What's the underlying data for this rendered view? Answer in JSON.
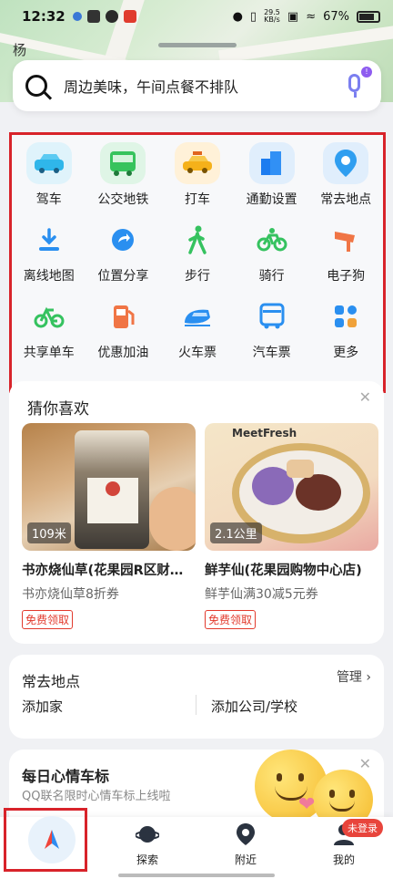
{
  "status_bar": {
    "time": "12:32",
    "net_speed_value": "29.5",
    "net_speed_unit": "KB/s",
    "battery": "67%"
  },
  "map": {
    "label": "杨"
  },
  "search": {
    "placeholder": "周边美味，午间点餐不排队",
    "mic_badge": "!"
  },
  "grid": [
    {
      "label": "驾车",
      "icon": "car-icon",
      "color": "#2fb6ea"
    },
    {
      "label": "公交地铁",
      "icon": "bus-icon",
      "color": "#37c35d"
    },
    {
      "label": "打车",
      "icon": "taxi-icon",
      "color": "#f5b11a"
    },
    {
      "label": "通勤设置",
      "icon": "commute-icon",
      "color": "#1c7cf0"
    },
    {
      "label": "常去地点",
      "icon": "location-pin-icon",
      "color": "#2f9ef0"
    },
    {
      "label": "离线地图",
      "icon": "download-icon",
      "color": "#2a8ff0"
    },
    {
      "label": "位置分享",
      "icon": "share-location-icon",
      "color": "#2a8ff0"
    },
    {
      "label": "步行",
      "icon": "walk-icon",
      "color": "#35c25f"
    },
    {
      "label": "骑行",
      "icon": "bicycle-icon",
      "color": "#35c25f"
    },
    {
      "label": "电子狗",
      "icon": "camera-icon",
      "color": "#f07545"
    },
    {
      "label": "共享单车",
      "icon": "shared-bike-icon",
      "color": "#35c25f"
    },
    {
      "label": "优惠加油",
      "icon": "fuel-icon",
      "color": "#f07545"
    },
    {
      "label": "火车票",
      "icon": "train-icon",
      "color": "#2a8ff0"
    },
    {
      "label": "汽车票",
      "icon": "coach-icon",
      "color": "#2a8ff0"
    },
    {
      "label": "更多",
      "icon": "more-grid-icon",
      "color": "#2a8ff0"
    }
  ],
  "guess": {
    "title": "猜你喜欢",
    "cards": [
      {
        "distance": "109米",
        "name": "书亦烧仙草(花果园R区财富...",
        "sub": "书亦烧仙草8折券",
        "coupon": "免费领取"
      },
      {
        "distance": "2.1公里",
        "name": "鲜芋仙(花果园购物中心店)",
        "sub": "鲜芋仙满30减5元券",
        "coupon": "免费领取",
        "logo": "MeetFresh"
      }
    ]
  },
  "frequent": {
    "title": "常去地点",
    "manage": "管理",
    "home": "添加家",
    "company": "添加公司/学校"
  },
  "mood": {
    "title": "每日心情车标",
    "sub": "QQ联名限时心情车标上线啦"
  },
  "nav": {
    "explore": "探索",
    "nearby": "附近",
    "mine": "我的",
    "badge": "未登录"
  }
}
